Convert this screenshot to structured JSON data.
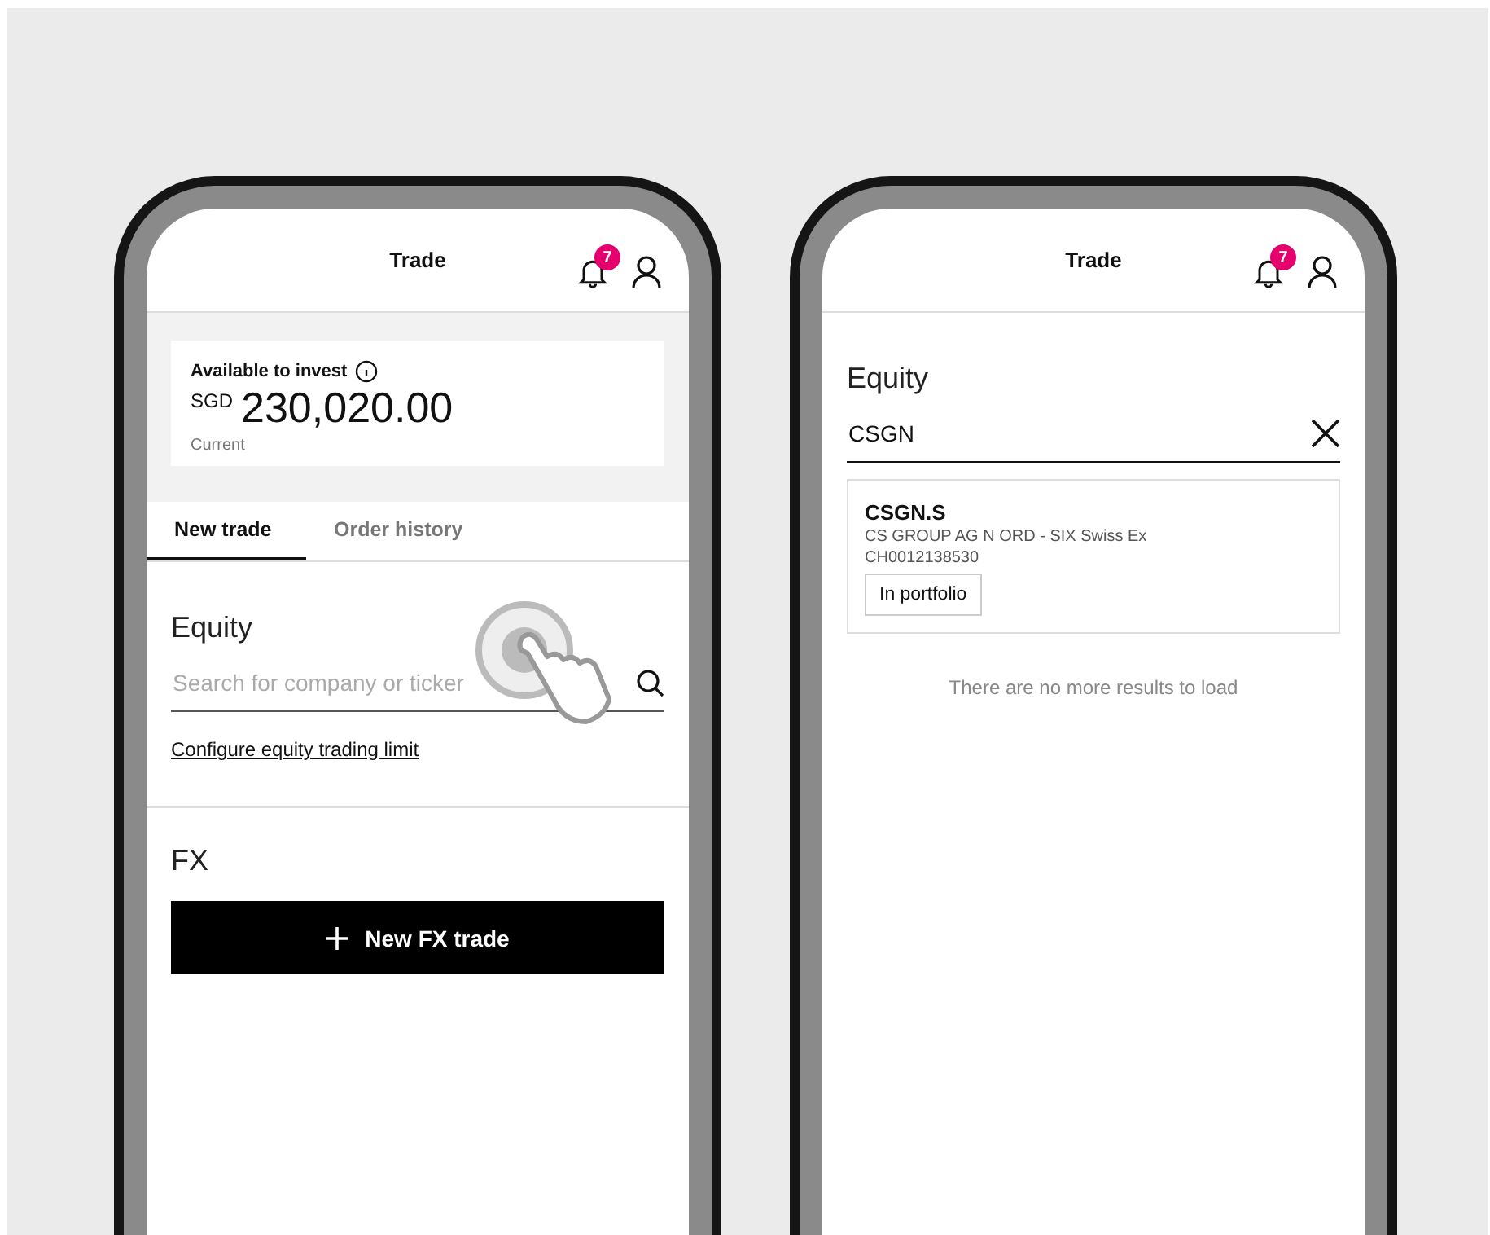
{
  "screens": [
    {
      "kind": "trade",
      "header": {
        "title": "Trade",
        "badge": "7"
      },
      "balance": {
        "label": "Available to invest",
        "currency": "SGD",
        "amount": "230,020.00",
        "note": "Current"
      },
      "tabs": [
        {
          "label": "New trade",
          "selected": true
        },
        {
          "label": "Order history",
          "selected": false
        }
      ],
      "equity": {
        "label": "Equity",
        "search": {
          "placeholder": "Search for company or ticker"
        },
        "link": "Configure equity trading limit"
      },
      "fx": {
        "label": "FX",
        "button": "New FX trade"
      }
    },
    {
      "kind": "search",
      "header": {
        "title": "Trade",
        "badge": "7"
      },
      "equity": {
        "label": "Equity",
        "search": {
          "value": "CSGN"
        }
      },
      "results": [
        {
          "ticker": "CSGN.S",
          "name": "CS GROUP AG N ORD - SIX Swiss Ex",
          "isin": "CH0012138530",
          "tag": "In portfolio"
        }
      ],
      "message": "There are no more results to load"
    }
  ]
}
